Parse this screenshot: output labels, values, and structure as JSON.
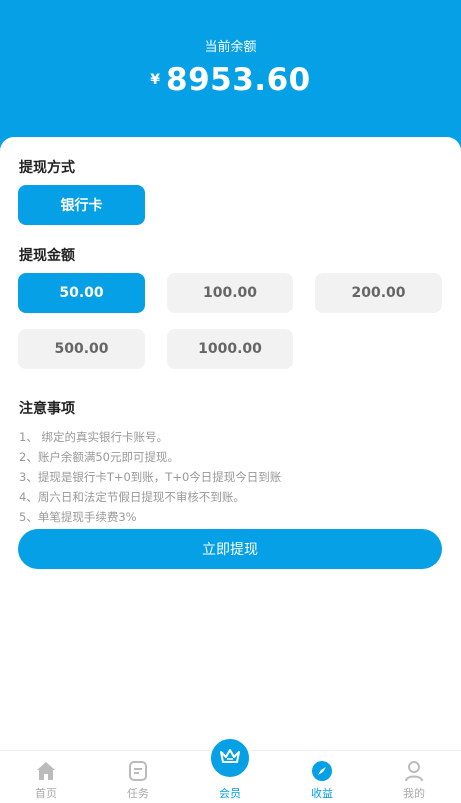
{
  "header": {
    "balance_label": "当前余额",
    "currency": "¥",
    "balance": "8953.60"
  },
  "method": {
    "title": "提现方式",
    "selected": "银行卡"
  },
  "amount": {
    "title": "提现金额",
    "options": [
      "50.00",
      "100.00",
      "200.00",
      "500.00",
      "1000.00"
    ],
    "selected_index": 0
  },
  "notes": {
    "title": "注意事项",
    "items": [
      "1、 绑定的真实银行卡账号。",
      "2、账户余额满50元即可提现。",
      "3、提现是银行卡T+0到账，T+0今日提现今日到账",
      "4、周六日和法定节假日提现不审核不到账。",
      "5、单笔提现手续费3%"
    ]
  },
  "submit_label": "立即提现",
  "tabbar": {
    "items": [
      {
        "label": "首页",
        "icon": "home-icon"
      },
      {
        "label": "任务",
        "icon": "task-icon"
      },
      {
        "label": "会员",
        "icon": "crown-icon"
      },
      {
        "label": "收益",
        "icon": "compass-icon"
      },
      {
        "label": "我的",
        "icon": "user-icon"
      }
    ],
    "active_index": 3
  },
  "colors": {
    "accent": "#05a0e6",
    "inactive_bg": "#f2f2f2"
  }
}
